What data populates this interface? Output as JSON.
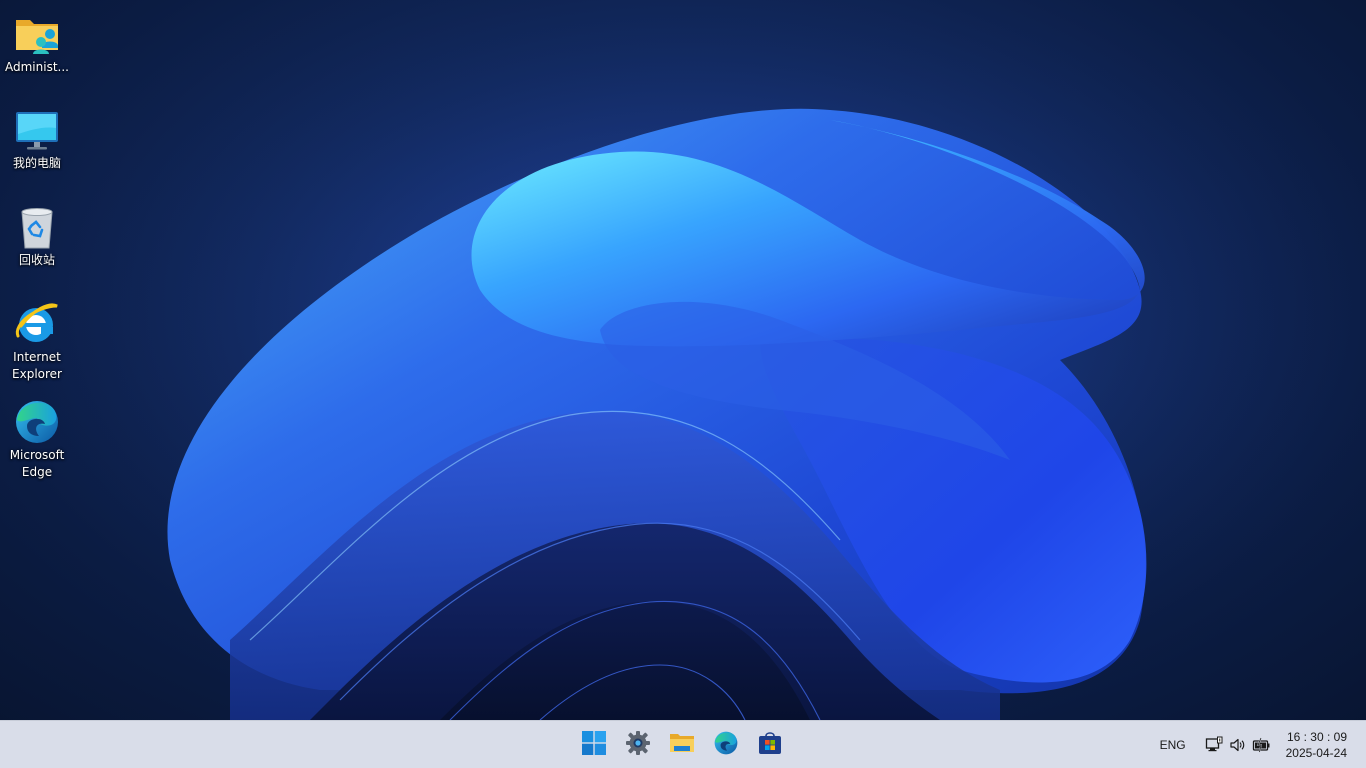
{
  "desktop": {
    "icons": [
      {
        "label": "Administ...",
        "icon": "user-folder-icon"
      },
      {
        "label": "我的电脑",
        "icon": "monitor-icon"
      },
      {
        "label": "回收站",
        "icon": "recycle-bin-icon"
      },
      {
        "label": "Internet\nExplorer",
        "icon": "internet-explorer-icon"
      },
      {
        "label": "Microsoft\nEdge",
        "icon": "edge-icon"
      }
    ]
  },
  "taskbar": {
    "pinned": [
      {
        "name": "start",
        "icon": "windows-start-icon"
      },
      {
        "name": "settings",
        "icon": "gear-icon"
      },
      {
        "name": "file-explorer",
        "icon": "folder-icon"
      },
      {
        "name": "edge",
        "icon": "edge-icon"
      },
      {
        "name": "store",
        "icon": "store-icon"
      }
    ],
    "tray": {
      "language": "ENG",
      "icons": [
        "network-icon",
        "volume-icon",
        "battery-icon"
      ],
      "time": "16 : 30 : 09",
      "date": "2025-04-24"
    }
  },
  "colors": {
    "taskbar_bg": "#d9dde9",
    "wallpaper_dark": "#08142f",
    "bloom_light": "#5fd0ff",
    "bloom_mid": "#2a63f5"
  }
}
